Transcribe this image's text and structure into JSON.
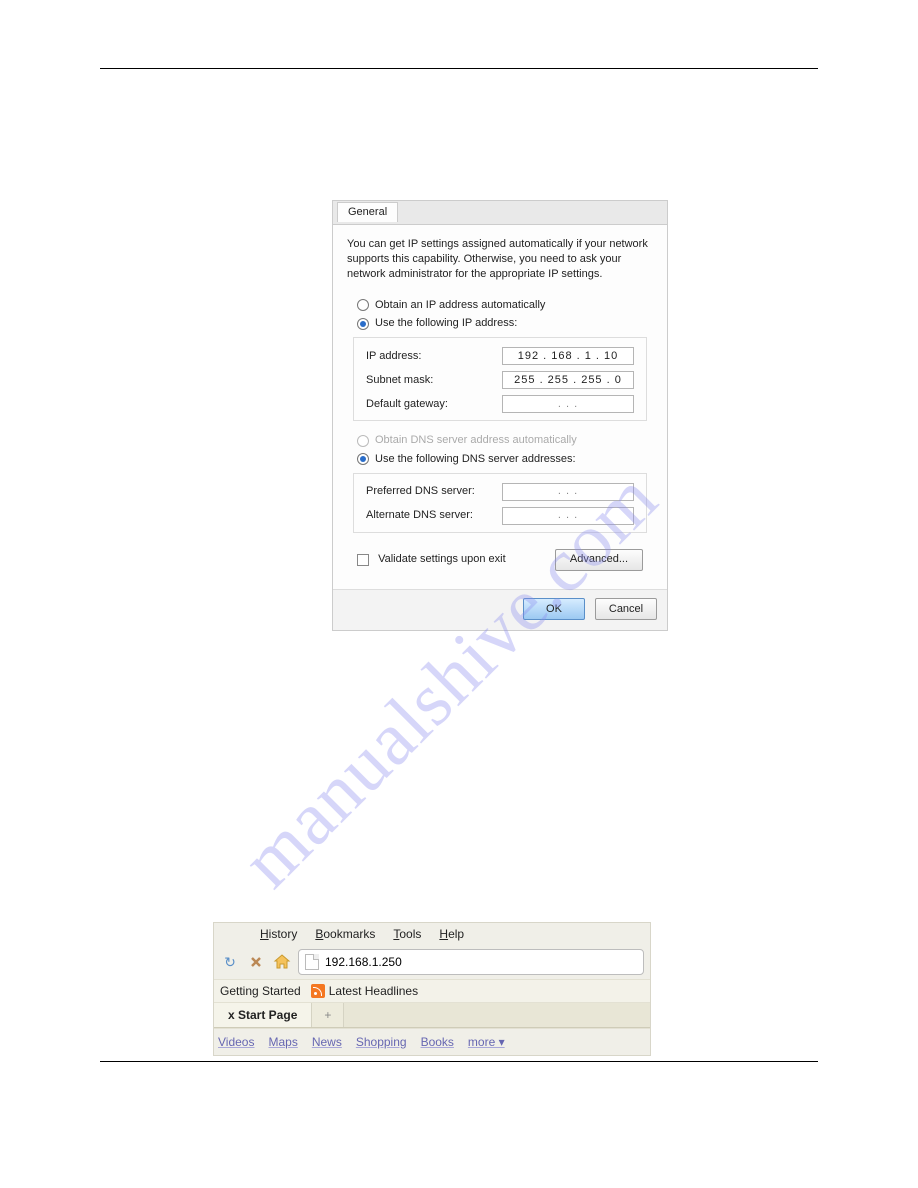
{
  "dialog": {
    "tab_label": "General",
    "description": "You can get IP settings assigned automatically if your network supports this capability. Otherwise, you need to ask your network administrator for the appropriate IP settings.",
    "radio_obtain_ip": "Obtain an IP address automatically",
    "radio_use_ip": "Use the following IP address:",
    "ip_address_label": "IP address:",
    "ip_address_value": "192 . 168 .  1  .  10",
    "subnet_label": "Subnet mask:",
    "subnet_value": "255 . 255 . 255 .  0",
    "gateway_label": "Default gateway:",
    "gateway_value": " .       .       . ",
    "radio_obtain_dns": "Obtain DNS server address automatically",
    "radio_use_dns": "Use the following DNS server addresses:",
    "pref_dns_label": "Preferred DNS server:",
    "pref_dns_value": " .       .       . ",
    "alt_dns_label": "Alternate DNS server:",
    "alt_dns_value": " .       .       . ",
    "validate_label": "Validate settings upon exit",
    "advanced_label": "Advanced...",
    "ok_label": "OK",
    "cancel_label": "Cancel"
  },
  "watermark": "manualshive.com",
  "browser": {
    "menu": {
      "history": "History",
      "bookmarks": "Bookmarks",
      "tools": "Tools",
      "help": "Help"
    },
    "address_value": "192.168.1.250",
    "bm_getting_started": "Getting Started",
    "bm_latest": "Latest Headlines",
    "tab_title": "x Start Page",
    "tab_plus": "+",
    "links": {
      "videos": "Videos",
      "maps": "Maps",
      "news": "News",
      "shopping": "Shopping",
      "books": "Books",
      "more": "more ▾"
    }
  }
}
